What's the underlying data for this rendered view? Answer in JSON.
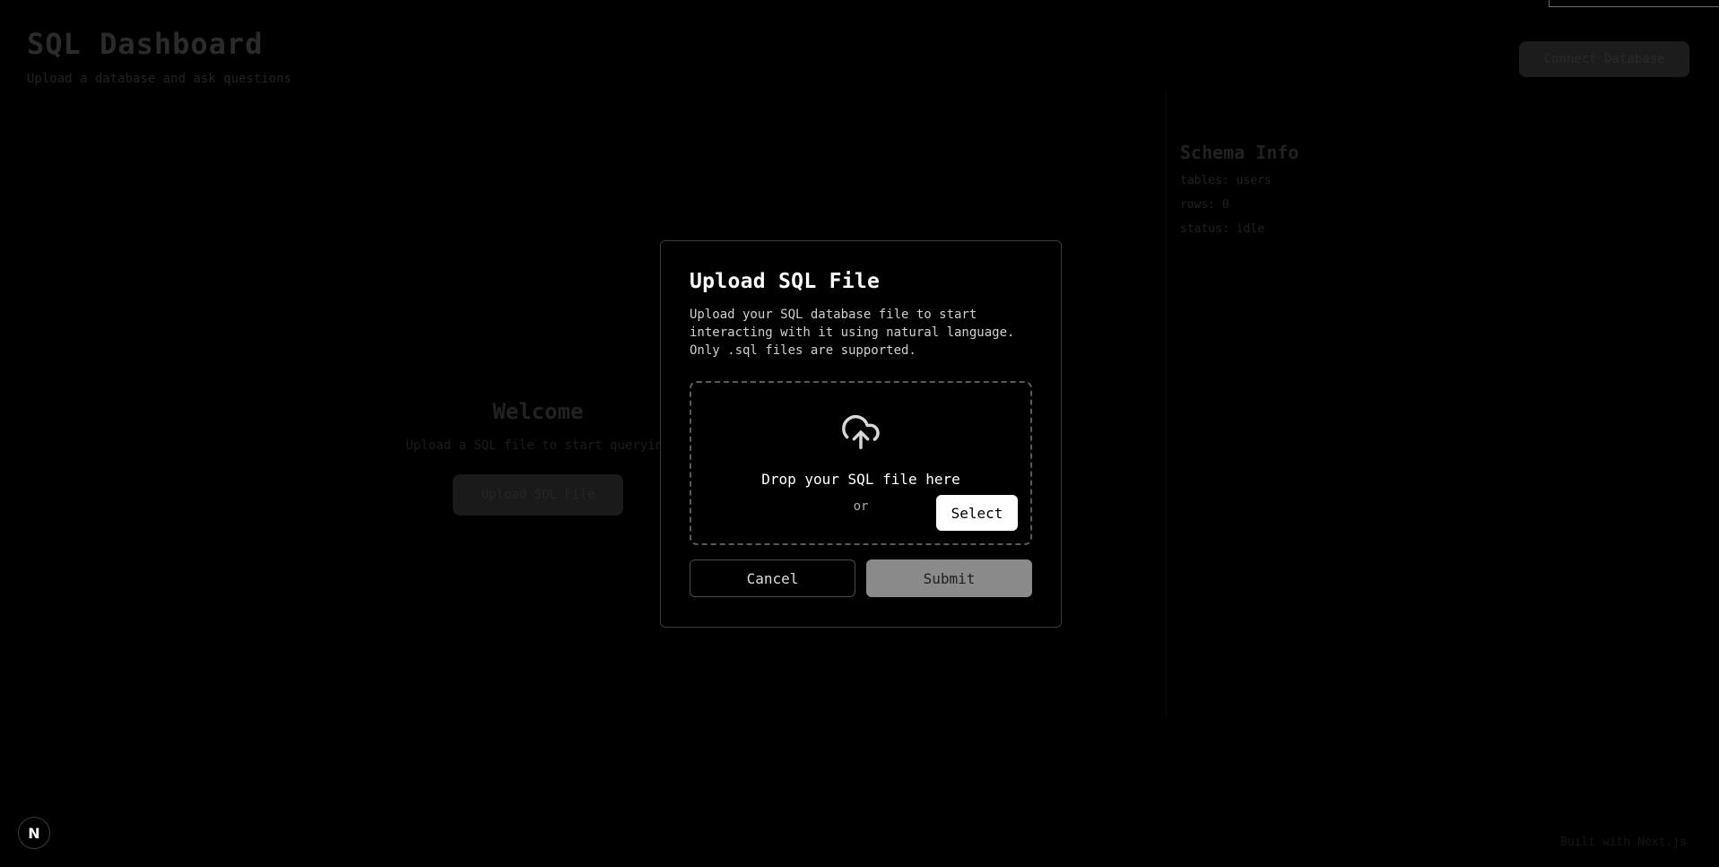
{
  "background": {
    "title": "SQL Dashboard",
    "subtitle": "Upload a database and ask questions",
    "connect_button": "Connect Database",
    "schema_title": "Schema Info",
    "schema_items": [
      "tables: users",
      "rows: 0",
      "status: idle"
    ],
    "center_title": "Welcome",
    "center_text": "Upload a SQL file to start querying",
    "center_button": "Upload SQL File",
    "footer": "Built with Next.js"
  },
  "modal": {
    "title": "Upload SQL File",
    "description": "Upload your SQL database file to start\ninteracting with it using natural language.\nOnly .sql files are supported.",
    "drop_text": "Drop your SQL file here",
    "or_text": "or",
    "select_label": "Select",
    "cancel_label": "Cancel",
    "submit_label": "Submit"
  },
  "dev_indicator": {
    "label": "N"
  },
  "icons": {
    "upload": "cloud-upload-icon"
  },
  "colors": {
    "modal_bg": "#000000",
    "submit_disabled": "#8a8a8a",
    "select_bg": "#ffffff"
  }
}
